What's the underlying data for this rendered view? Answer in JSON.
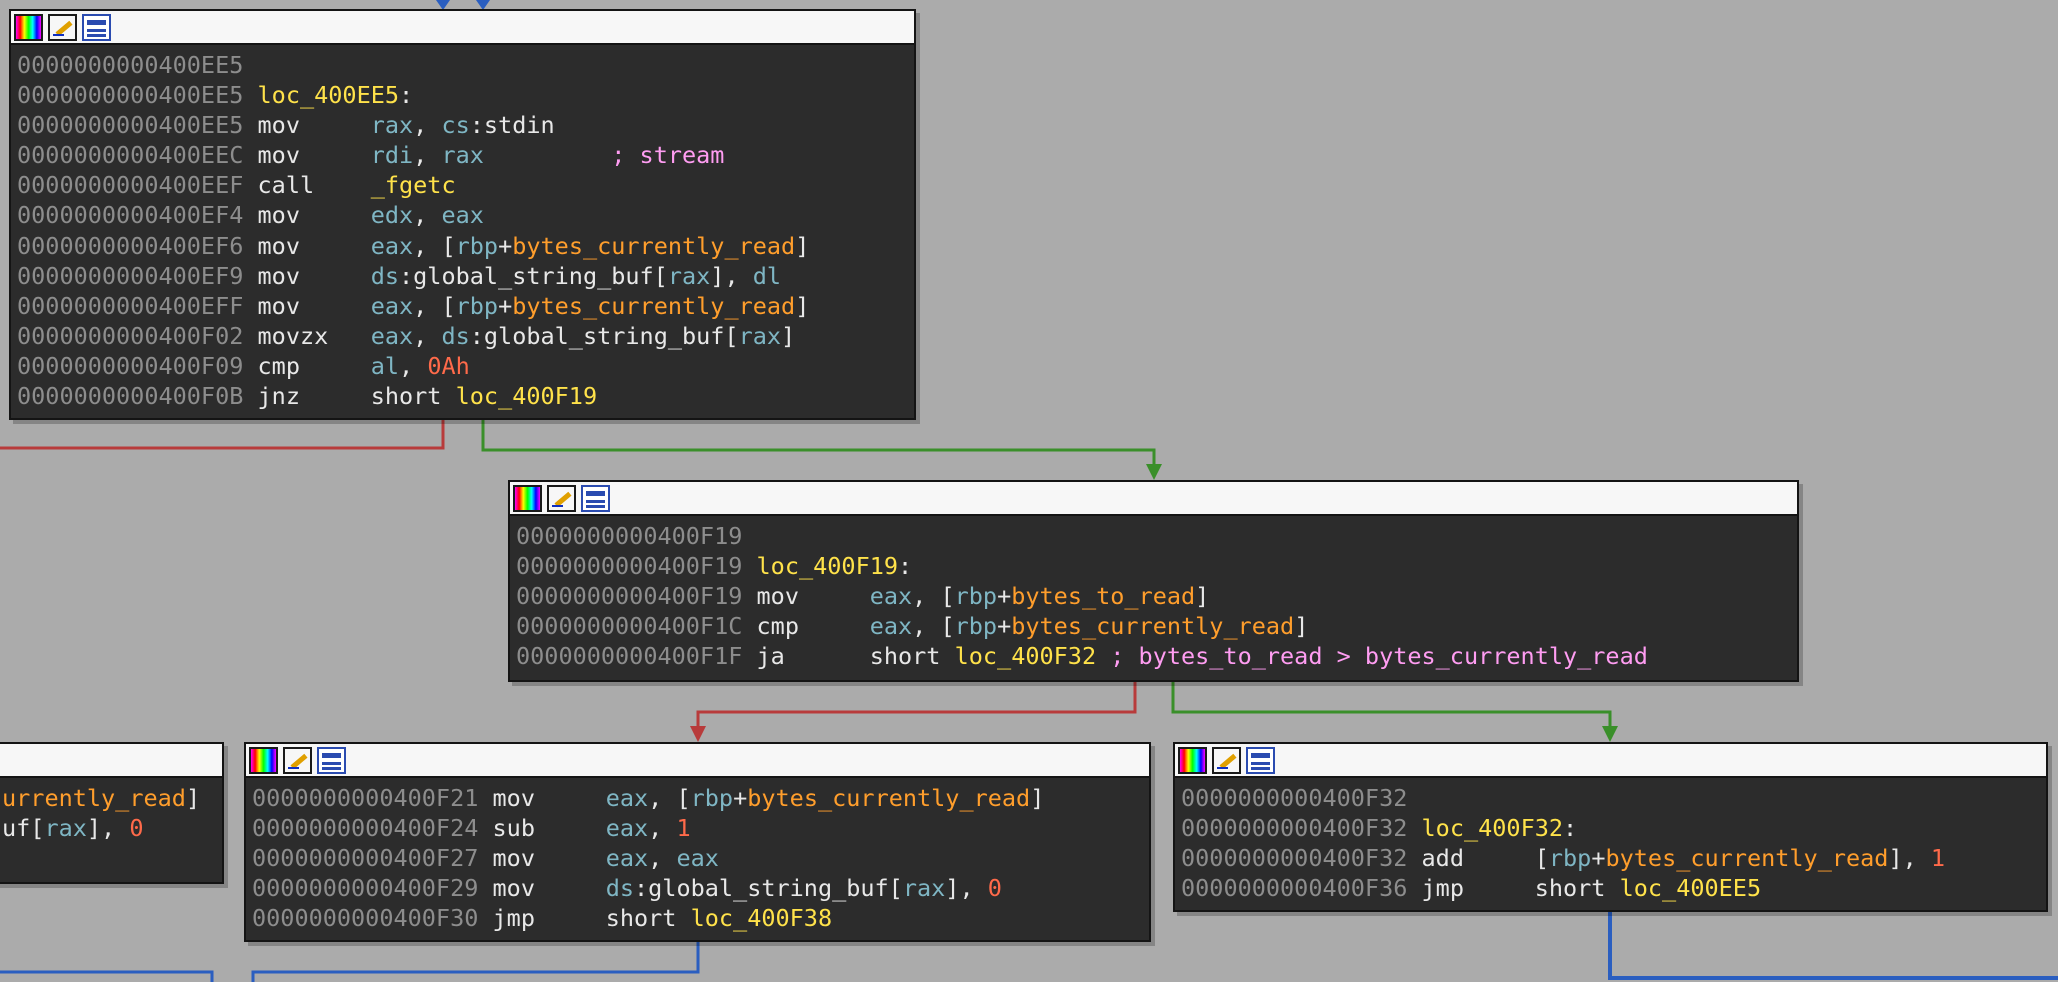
{
  "colors": {
    "background": "#ababab",
    "node_bg": "#2c2c2c",
    "edge_true": "#3a8f2a",
    "edge_false": "#b83b3b",
    "edge_uncond": "#2a5ec0"
  },
  "header_icons": [
    "color-palette-icon",
    "rename-pencil-icon",
    "graph-overview-icon"
  ],
  "nodes": [
    {
      "id": "n_400EE5",
      "lines": [
        {
          "addr": "0000000000400EE5",
          "parts": []
        },
        {
          "addr": "0000000000400EE5",
          "parts": [
            {
              "t": "loc_400EE5",
              "c": "sym"
            },
            {
              "t": ":",
              "c": "pun"
            }
          ]
        },
        {
          "addr": "0000000000400EE5",
          "parts": [
            {
              "t": "mov",
              "c": "mn",
              "pad": 8
            },
            {
              "t": "rax",
              "c": "reg"
            },
            {
              "t": ", ",
              "c": "pun"
            },
            {
              "t": "cs",
              "c": "seg"
            },
            {
              "t": ":stdin",
              "c": "pun"
            }
          ]
        },
        {
          "addr": "0000000000400EEC",
          "parts": [
            {
              "t": "mov",
              "c": "mn",
              "pad": 8
            },
            {
              "t": "rdi",
              "c": "reg"
            },
            {
              "t": ", ",
              "c": "pun"
            },
            {
              "t": "rax",
              "c": "reg"
            },
            {
              "t": "         ",
              "c": "pun"
            },
            {
              "t": "; stream",
              "c": "cmt"
            }
          ]
        },
        {
          "addr": "0000000000400EEF",
          "parts": [
            {
              "t": "call",
              "c": "mn",
              "pad": 8
            },
            {
              "t": "_fgetc",
              "c": "sym"
            }
          ]
        },
        {
          "addr": "0000000000400EF4",
          "parts": [
            {
              "t": "mov",
              "c": "mn",
              "pad": 8
            },
            {
              "t": "edx",
              "c": "reg"
            },
            {
              "t": ", ",
              "c": "pun"
            },
            {
              "t": "eax",
              "c": "reg"
            }
          ]
        },
        {
          "addr": "0000000000400EF6",
          "parts": [
            {
              "t": "mov",
              "c": "mn",
              "pad": 8
            },
            {
              "t": "eax",
              "c": "reg"
            },
            {
              "t": ", [",
              "c": "pun"
            },
            {
              "t": "rbp",
              "c": "reg"
            },
            {
              "t": "+",
              "c": "pun"
            },
            {
              "t": "bytes_currently_read",
              "c": "off"
            },
            {
              "t": "]",
              "c": "pun"
            }
          ]
        },
        {
          "addr": "0000000000400EF9",
          "parts": [
            {
              "t": "mov",
              "c": "mn",
              "pad": 8
            },
            {
              "t": "ds",
              "c": "seg"
            },
            {
              "t": ":global_string_buf[",
              "c": "pun"
            },
            {
              "t": "rax",
              "c": "reg"
            },
            {
              "t": "], ",
              "c": "pun"
            },
            {
              "t": "dl",
              "c": "reg"
            }
          ]
        },
        {
          "addr": "0000000000400EFF",
          "parts": [
            {
              "t": "mov",
              "c": "mn",
              "pad": 8
            },
            {
              "t": "eax",
              "c": "reg"
            },
            {
              "t": ", [",
              "c": "pun"
            },
            {
              "t": "rbp",
              "c": "reg"
            },
            {
              "t": "+",
              "c": "pun"
            },
            {
              "t": "bytes_currently_read",
              "c": "off"
            },
            {
              "t": "]",
              "c": "pun"
            }
          ]
        },
        {
          "addr": "0000000000400F02",
          "parts": [
            {
              "t": "movzx",
              "c": "mn",
              "pad": 8
            },
            {
              "t": "eax",
              "c": "reg"
            },
            {
              "t": ", ",
              "c": "pun"
            },
            {
              "t": "ds",
              "c": "seg"
            },
            {
              "t": ":global_string_buf[",
              "c": "pun"
            },
            {
              "t": "rax",
              "c": "reg"
            },
            {
              "t": "]",
              "c": "pun"
            }
          ]
        },
        {
          "addr": "0000000000400F09",
          "parts": [
            {
              "t": "cmp",
              "c": "mn",
              "pad": 8
            },
            {
              "t": "al",
              "c": "reg"
            },
            {
              "t": ", ",
              "c": "pun"
            },
            {
              "t": "0Ah",
              "c": "num"
            }
          ]
        },
        {
          "addr": "0000000000400F0B",
          "parts": [
            {
              "t": "jnz",
              "c": "mn",
              "pad": 8
            },
            {
              "t": "short ",
              "c": "pun"
            },
            {
              "t": "loc_400F19",
              "c": "sym"
            }
          ]
        }
      ]
    },
    {
      "id": "n_400F19",
      "lines": [
        {
          "addr": "0000000000400F19",
          "parts": []
        },
        {
          "addr": "0000000000400F19",
          "parts": [
            {
              "t": "loc_400F19",
              "c": "sym"
            },
            {
              "t": ":",
              "c": "pun"
            }
          ]
        },
        {
          "addr": "0000000000400F19",
          "parts": [
            {
              "t": "mov",
              "c": "mn",
              "pad": 8
            },
            {
              "t": "eax",
              "c": "reg"
            },
            {
              "t": ", [",
              "c": "pun"
            },
            {
              "t": "rbp",
              "c": "reg"
            },
            {
              "t": "+",
              "c": "pun"
            },
            {
              "t": "bytes_to_read",
              "c": "off"
            },
            {
              "t": "]",
              "c": "pun"
            }
          ]
        },
        {
          "addr": "0000000000400F1C",
          "parts": [
            {
              "t": "cmp",
              "c": "mn",
              "pad": 8
            },
            {
              "t": "eax",
              "c": "reg"
            },
            {
              "t": ", [",
              "c": "pun"
            },
            {
              "t": "rbp",
              "c": "reg"
            },
            {
              "t": "+",
              "c": "pun"
            },
            {
              "t": "bytes_currently_read",
              "c": "off"
            },
            {
              "t": "]",
              "c": "pun"
            }
          ]
        },
        {
          "addr": "0000000000400F1F",
          "parts": [
            {
              "t": "ja",
              "c": "mn",
              "pad": 8
            },
            {
              "t": "short ",
              "c": "pun"
            },
            {
              "t": "loc_400F32",
              "c": "sym"
            },
            {
              "t": " ",
              "c": "pun"
            },
            {
              "t": "; bytes_to_read > bytes_currently_read",
              "c": "cmt"
            }
          ]
        }
      ]
    },
    {
      "id": "n_400F21",
      "lines": [
        {
          "addr": "0000000000400F21",
          "parts": [
            {
              "t": "mov",
              "c": "mn",
              "pad": 8
            },
            {
              "t": "eax",
              "c": "reg"
            },
            {
              "t": ", [",
              "c": "pun"
            },
            {
              "t": "rbp",
              "c": "reg"
            },
            {
              "t": "+",
              "c": "pun"
            },
            {
              "t": "bytes_currently_read",
              "c": "off"
            },
            {
              "t": "]",
              "c": "pun"
            }
          ]
        },
        {
          "addr": "0000000000400F24",
          "parts": [
            {
              "t": "sub",
              "c": "mn",
              "pad": 8
            },
            {
              "t": "eax",
              "c": "reg"
            },
            {
              "t": ", ",
              "c": "pun"
            },
            {
              "t": "1",
              "c": "num"
            }
          ]
        },
        {
          "addr": "0000000000400F27",
          "parts": [
            {
              "t": "mov",
              "c": "mn",
              "pad": 8
            },
            {
              "t": "eax",
              "c": "reg"
            },
            {
              "t": ", ",
              "c": "pun"
            },
            {
              "t": "eax",
              "c": "reg"
            }
          ]
        },
        {
          "addr": "0000000000400F29",
          "parts": [
            {
              "t": "mov",
              "c": "mn",
              "pad": 8
            },
            {
              "t": "ds",
              "c": "seg"
            },
            {
              "t": ":global_string_buf[",
              "c": "pun"
            },
            {
              "t": "rax",
              "c": "reg"
            },
            {
              "t": "], ",
              "c": "pun"
            },
            {
              "t": "0",
              "c": "num"
            }
          ]
        },
        {
          "addr": "0000000000400F30",
          "parts": [
            {
              "t": "jmp",
              "c": "mn",
              "pad": 8
            },
            {
              "t": "short ",
              "c": "pun"
            },
            {
              "t": "loc_400F38",
              "c": "sym"
            }
          ]
        }
      ]
    },
    {
      "id": "n_400F32",
      "lines": [
        {
          "addr": "0000000000400F32",
          "parts": []
        },
        {
          "addr": "0000000000400F32",
          "parts": [
            {
              "t": "loc_400F32",
              "c": "sym"
            },
            {
              "t": ":",
              "c": "pun"
            }
          ]
        },
        {
          "addr": "0000000000400F32",
          "parts": [
            {
              "t": "add",
              "c": "mn",
              "pad": 8
            },
            {
              "t": "[",
              "c": "pun"
            },
            {
              "t": "rbp",
              "c": "reg"
            },
            {
              "t": "+",
              "c": "pun"
            },
            {
              "t": "bytes_currently_read",
              "c": "off"
            },
            {
              "t": "], ",
              "c": "pun"
            },
            {
              "t": "1",
              "c": "num"
            }
          ]
        },
        {
          "addr": "0000000000400F36",
          "parts": [
            {
              "t": "jmp",
              "c": "mn",
              "pad": 8
            },
            {
              "t": "short ",
              "c": "pun"
            },
            {
              "t": "loc_400EE5",
              "c": "sym"
            }
          ]
        }
      ]
    },
    {
      "id": "n_left_partial",
      "lines": [
        {
          "addr": "",
          "parts": [
            {
              "t": "urrently_read",
              "c": "off"
            },
            {
              "t": "]",
              "c": "pun"
            }
          ]
        },
        {
          "addr": "",
          "parts": [
            {
              "t": "uf[",
              "c": "pun"
            },
            {
              "t": "rax",
              "c": "reg"
            },
            {
              "t": "], ",
              "c": "pun"
            },
            {
              "t": "0",
              "c": "num"
            }
          ]
        }
      ]
    }
  ]
}
